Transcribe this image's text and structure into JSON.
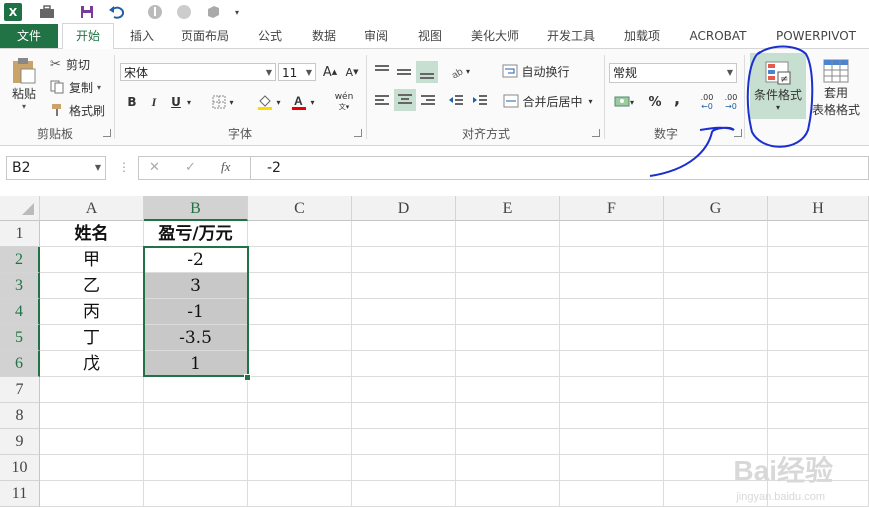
{
  "quick_access": {
    "app_icon": "excel-logo-icon",
    "icons": [
      "briefcase-icon",
      "save-icon",
      "undo-icon",
      "touch-mode-icon",
      "circle-icon",
      "cube-icon",
      "more-icon"
    ],
    "excel_letter": "X"
  },
  "tabs": [
    "文件",
    "开始",
    "插入",
    "页面布局",
    "公式",
    "数据",
    "审阅",
    "视图",
    "美化大师",
    "开发工具",
    "加载项",
    "ACROBAT",
    "POWERPIVOT"
  ],
  "ribbon": {
    "clipboard": {
      "paste": "粘贴",
      "cut": "剪切",
      "copy": "复制",
      "format_painter": "格式刷",
      "label": "剪贴板"
    },
    "font": {
      "name": "宋体",
      "size": "11",
      "grow": "A",
      "shrink": "A",
      "bold": "B",
      "italic": "I",
      "underline": "U",
      "phonetic": "wén",
      "label": "字体"
    },
    "alignment": {
      "wrap": "自动换行",
      "merge": "合并后居中",
      "label": "对齐方式"
    },
    "number": {
      "format": "常规",
      "percent": "%",
      "comma": ",",
      "inc_decimal": ".00",
      "dec_decimal": ".00",
      "label": "数字"
    },
    "styles": {
      "conditional": "条件格式",
      "table_line1": "套用",
      "table_line2": "表格格式"
    }
  },
  "formula_bar": {
    "name_box": "B2",
    "cancel": "✕",
    "enter": "✓",
    "fx": "fx",
    "value": "-2"
  },
  "columns": [
    "A",
    "B",
    "C",
    "D",
    "E",
    "F",
    "G",
    "H"
  ],
  "rows": [
    "1",
    "2",
    "3",
    "4",
    "5",
    "6",
    "7",
    "8",
    "9",
    "10",
    "11"
  ],
  "cells": {
    "A1": "姓名",
    "B1": "盈亏/万元",
    "A2": "甲",
    "B2": "-2",
    "A3": "乙",
    "B3": "3",
    "A4": "丙",
    "B4": "-1",
    "A5": "丁",
    "B5": "-3.5",
    "A6": "戊",
    "B6": "1"
  },
  "watermark": {
    "line1": "Bai经验",
    "line2": "jingyan.baidu.com"
  },
  "colors": {
    "excel_green": "#217346",
    "selection_fill": "#c8c8c8",
    "annotation_ink": "#1a2fd0"
  }
}
